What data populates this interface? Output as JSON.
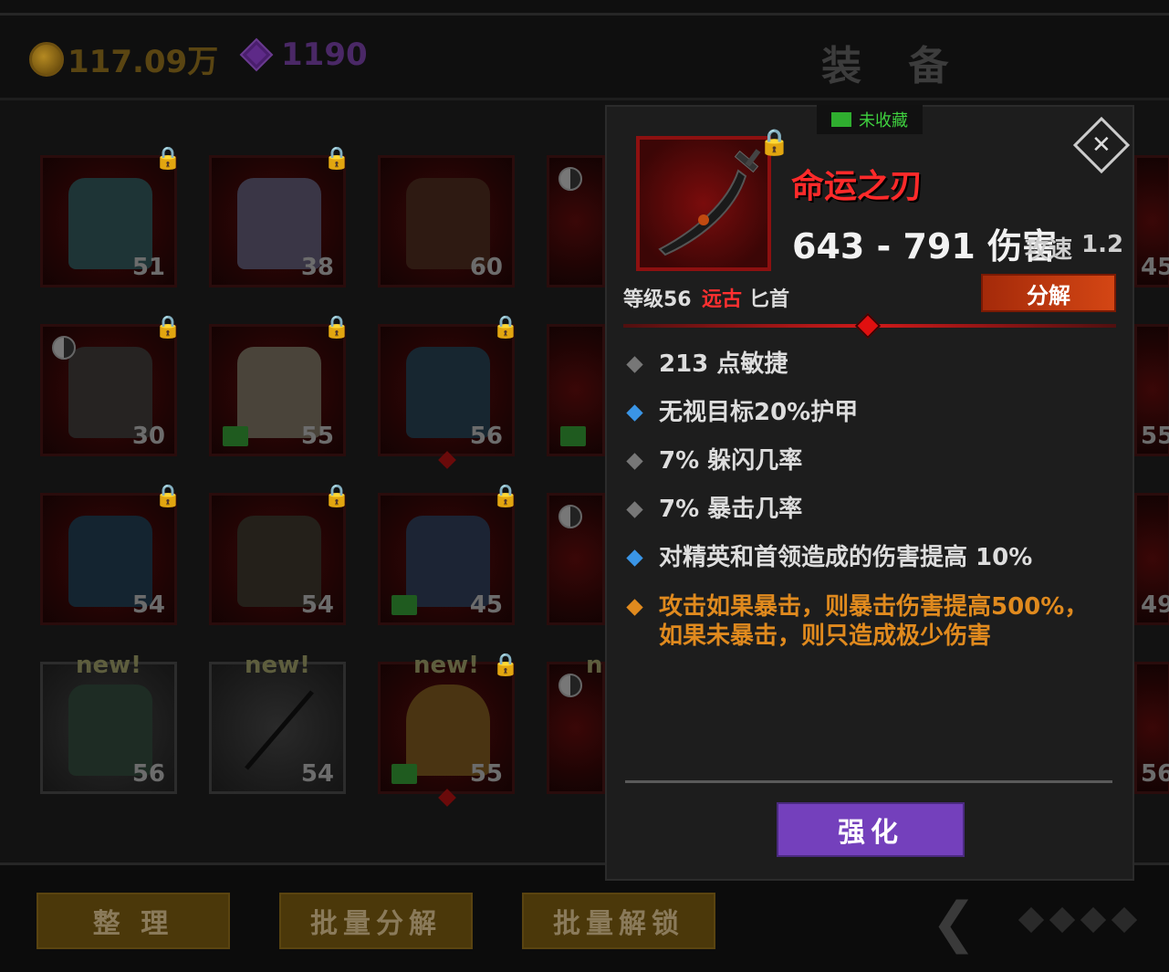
{
  "header": {
    "coins": "117.09万",
    "gems": "1190",
    "title": "装 备"
  },
  "grid": {
    "slots": [
      {
        "level": "51"
      },
      {
        "level": "38"
      },
      {
        "level": "60"
      },
      {
        "level": "30"
      },
      {
        "level": "55"
      },
      {
        "level": "56"
      },
      {
        "level": "54"
      },
      {
        "level": "54"
      },
      {
        "level": "45"
      },
      {
        "level": "56",
        "badge": "new!"
      },
      {
        "level": "54",
        "badge": "new!"
      },
      {
        "level": "55",
        "badge": "new!"
      }
    ],
    "edge_levels": [
      "45",
      "55",
      "49",
      "56"
    ],
    "edge_new": "n"
  },
  "bottom": {
    "sort_label": "整 理",
    "batch_decompose_label": "批量分解",
    "batch_unlock_label": "批量解锁"
  },
  "popup": {
    "collect_label": "未收藏",
    "close_label": "✕",
    "item_name": "命运之刃",
    "damage": "643 - 791 伤害",
    "attack_speed_label": "攻速",
    "attack_speed_value": "1.2",
    "level_label": "等级56",
    "rarity": "远古",
    "item_type": "匕首",
    "decompose_label": "分解",
    "stats": [
      {
        "text": "213 点敏捷",
        "color": "#ddd",
        "diamond": "#777"
      },
      {
        "text": "无视目标20%护甲",
        "color": "#ddd",
        "diamond": "#3a95e6"
      },
      {
        "text": "7% 躲闪几率",
        "color": "#ddd",
        "diamond": "#777"
      },
      {
        "text": "7% 暴击几率",
        "color": "#ddd",
        "diamond": "#777"
      },
      {
        "text": "对精英和首领造成的伤害提高 10%",
        "color": "#ddd",
        "diamond": "#3a95e6"
      },
      {
        "text": "攻击如果暴击，则暴击伤害提高500%，如果未暴击，则只造成极少伤害",
        "color": "#e08a1e",
        "diamond": "#e08a1e"
      }
    ],
    "enhance_label": "强化"
  },
  "colors": {
    "gold_text": "#5a4512",
    "gem_text": "#4a2866",
    "rarity_red": "#ff3030",
    "enhance_purple": "#7440bc",
    "decompose_orange": "#d44614"
  }
}
